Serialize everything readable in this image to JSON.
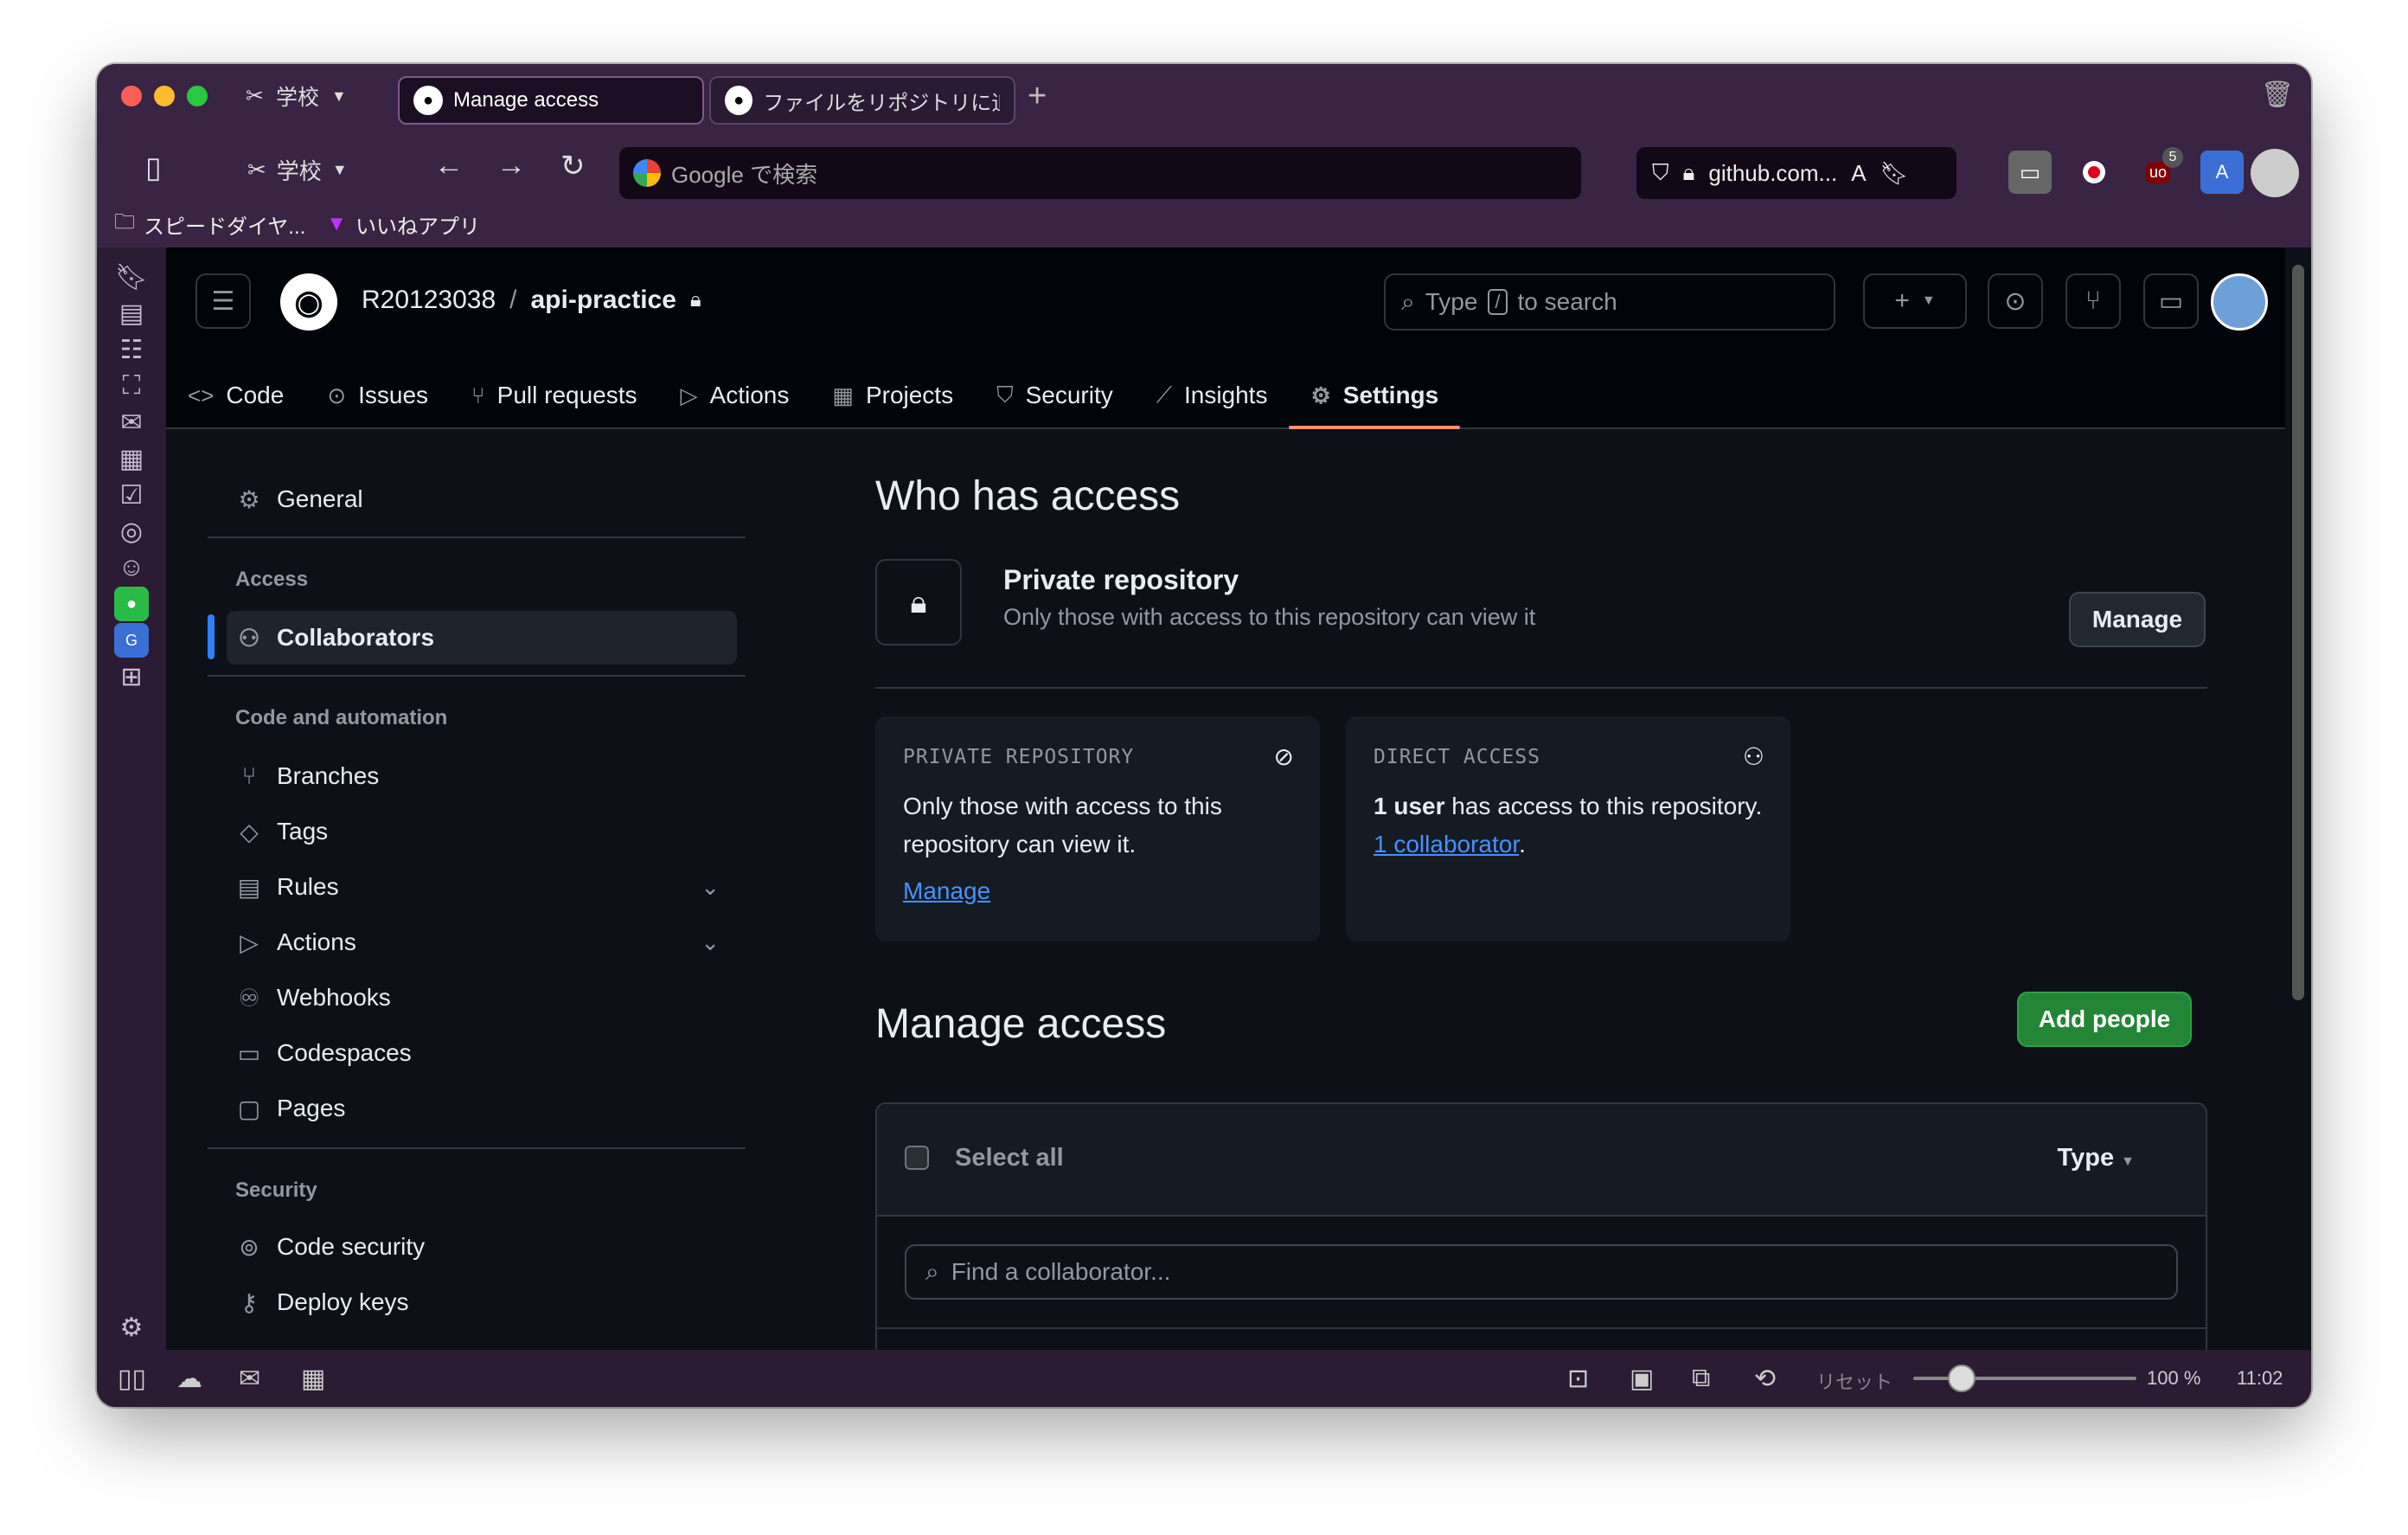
{
  "browser": {
    "workspace_label": "学校",
    "tabs": [
      {
        "title": "Manage access",
        "active": true
      },
      {
        "title": "ファイルをリポジトリに追",
        "active": false
      }
    ],
    "url_placeholder": "Google で検索",
    "site_label": "github.com...",
    "extension_badge": "5",
    "bookmarks": [
      {
        "label": "スピードダイヤ..."
      },
      {
        "label": "いいねアプリ"
      }
    ]
  },
  "statusbar": {
    "reset_label": "リセット",
    "zoom": "100 %",
    "zoom_percent": 100,
    "time": "11:02"
  },
  "header": {
    "owner": "R20123038",
    "separator": "/",
    "repo": "api-practice",
    "search_prefix": "Type",
    "search_key": "/",
    "search_suffix": "to search"
  },
  "repo_nav": [
    {
      "label": "Code",
      "icon": "code-icon"
    },
    {
      "label": "Issues",
      "icon": "issue-icon"
    },
    {
      "label": "Pull requests",
      "icon": "pull-request-icon"
    },
    {
      "label": "Actions",
      "icon": "play-icon"
    },
    {
      "label": "Projects",
      "icon": "table-icon"
    },
    {
      "label": "Security",
      "icon": "shield-icon"
    },
    {
      "label": "Insights",
      "icon": "graph-icon"
    },
    {
      "label": "Settings",
      "icon": "gear-icon",
      "active": true
    }
  ],
  "settings_sidebar": {
    "general": "General",
    "access_heading": "Access",
    "collaborators": "Collaborators",
    "code_heading": "Code and automation",
    "branches": "Branches",
    "tags": "Tags",
    "rules": "Rules",
    "actions": "Actions",
    "webhooks": "Webhooks",
    "codespaces": "Codespaces",
    "pages": "Pages",
    "security_heading": "Security",
    "code_security": "Code security",
    "deploy_keys": "Deploy keys"
  },
  "main": {
    "who_title": "Who has access",
    "private_title": "Private repository",
    "private_sub": "Only those with access to this repository can view it",
    "manage_button": "Manage",
    "card1": {
      "title": "PRIVATE REPOSITORY",
      "body": "Only those with access to this repository can view it.",
      "link": "Manage"
    },
    "card2": {
      "title": "DIRECT ACCESS",
      "bold": "1 user",
      "body1": " has access to this repository. ",
      "link": "1 collaborator",
      "body2": "."
    },
    "manage_title": "Manage access",
    "add_people": "Add people",
    "select_all": "Select all",
    "type_filter": "Type",
    "find_placeholder": "Find a collaborator..."
  },
  "colors": {
    "accent_tab_underline": "#fd8c73",
    "link": "#4493f8",
    "green_button": "#238636",
    "browser_chrome": "#3a2444"
  }
}
